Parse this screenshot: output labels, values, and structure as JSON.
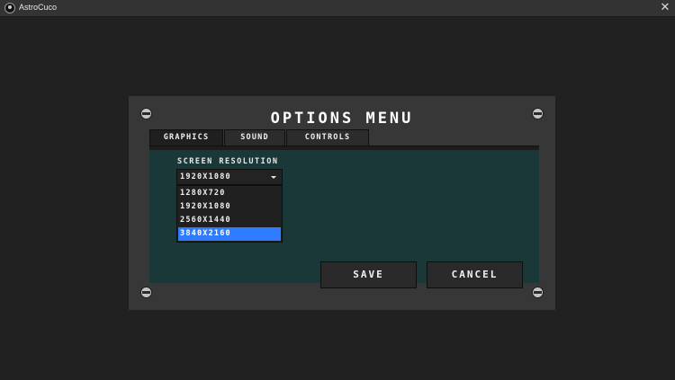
{
  "window": {
    "title": "AstroCuco",
    "close_glyph": "✕",
    "app_icon": "app-icon"
  },
  "options": {
    "title": "OPTIONS MENU",
    "tabs": [
      {
        "label": "GRAPHICS",
        "active": true
      },
      {
        "label": "SOUND",
        "active": false
      },
      {
        "label": "CONTROLS",
        "active": false
      }
    ],
    "graphics": {
      "resolution_label": "SCREEN RESOLUTION",
      "resolution_value": "1920X1080",
      "resolution_options": [
        {
          "label": "1280X720",
          "highlighted": false
        },
        {
          "label": "1920X1080",
          "highlighted": false
        },
        {
          "label": "2560X1440",
          "highlighted": false
        },
        {
          "label": "3840X2160",
          "highlighted": true
        }
      ]
    },
    "buttons": {
      "save": "SAVE",
      "cancel": "CANCEL"
    }
  },
  "colors": {
    "background": "#212121",
    "panel": "#373737",
    "content": "#1b3838",
    "highlight": "#2f7bff"
  }
}
